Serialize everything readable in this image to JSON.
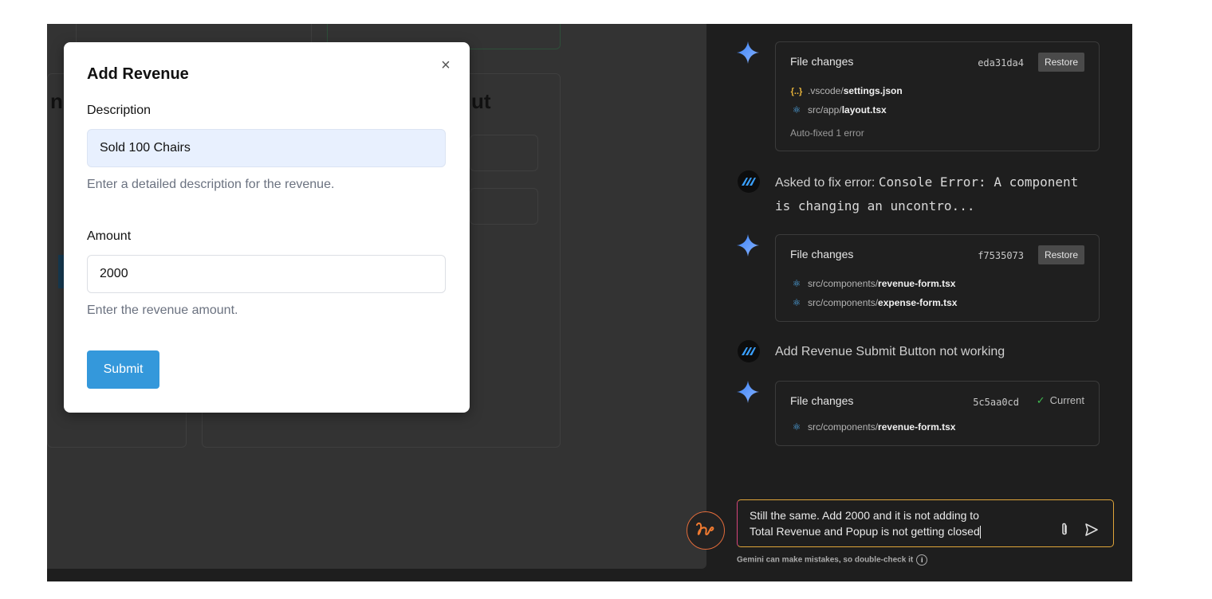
{
  "modal": {
    "title": "Add Revenue",
    "close_icon": "×",
    "description_label": "Description",
    "description_value": "Sold 100 Chairs",
    "description_help": "Enter a detailed description for the revenue.",
    "amount_label": "Amount",
    "amount_value": "2000",
    "amount_help": "Enter the revenue amount.",
    "submit_label": "Submit"
  },
  "background": {
    "partial_heading_left": "nd",
    "partial_heading_right": "ut"
  },
  "chat": {
    "cards": [
      {
        "title": "File changes",
        "hash": "eda31da4",
        "action": "Restore",
        "files": [
          {
            "dir": ".vscode/",
            "name": "settings.json",
            "icon": "json-braces-icon"
          },
          {
            "dir": "src/app/",
            "name": "layout.tsx",
            "icon": "react-icon"
          }
        ],
        "note": "Auto-fixed 1 error"
      },
      {
        "title": "File changes",
        "hash": "f7535073",
        "action": "Restore",
        "files": [
          {
            "dir": "src/components/",
            "name": "revenue-form.tsx",
            "icon": "react-icon"
          },
          {
            "dir": "src/components/",
            "name": "expense-form.tsx",
            "icon": "react-icon"
          }
        ]
      },
      {
        "title": "File changes",
        "hash": "5c5aa0cd",
        "status": "Current",
        "files": [
          {
            "dir": "src/components/",
            "name": "revenue-form.tsx",
            "icon": "react-icon"
          }
        ]
      }
    ],
    "messages": [
      {
        "prefix": "Asked to fix error: ",
        "code_line1": "Console Error: A component",
        "code_line2": "is changing an uncontro..."
      },
      {
        "text": "Add Revenue Submit Button not working"
      }
    ],
    "prompt_line1": "Still the same. Add 2000 and it is not adding to",
    "prompt_line2": "Total Revenue and Popup is not getting closed",
    "disclaimer": "Gemini can make mistakes, so double-check it",
    "info_icon": "i",
    "colors": {
      "spark_start": "#4f8ff7",
      "spark_end": "#7aa7ff",
      "current_check": "#3fb950",
      "prompt_border": "#e0a53a",
      "submit_bg": "#3498db"
    }
  }
}
